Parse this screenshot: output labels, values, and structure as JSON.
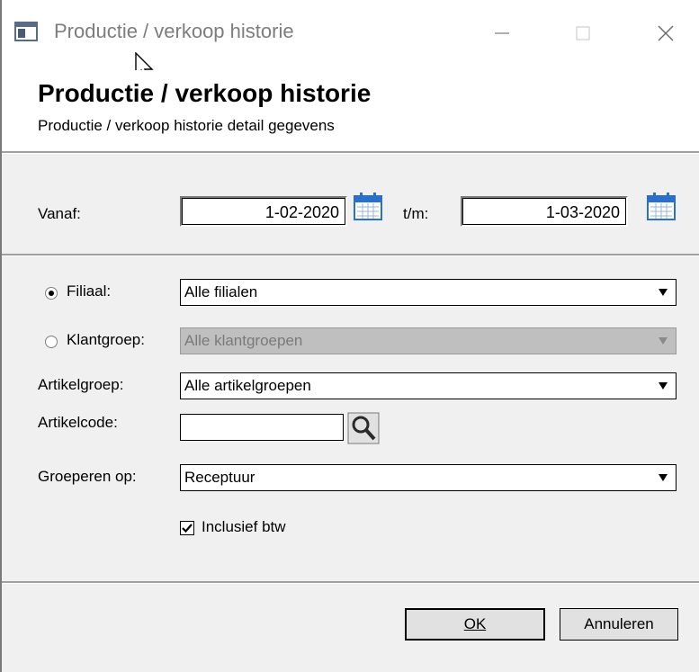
{
  "window": {
    "title": "Productie / verkoop historie",
    "controls": {
      "minimize": "—",
      "maximize": "☐",
      "close": "✕"
    }
  },
  "header": {
    "title": "Productie / verkoop historie",
    "subtitle": "Productie / verkoop historie detail gegevens"
  },
  "dates": {
    "from_label": "Vanaf:",
    "from_value": "1-02-2020",
    "to_label": "t/m:",
    "to_value": "1-03-2020"
  },
  "filters": {
    "filiaal_label": "Filiaal:",
    "filiaal_value": "Alle filialen",
    "filiaal_selected": true,
    "klantgroep_label": "Klantgroep:",
    "klantgroep_value": "Alle klantgroepen",
    "klantgroep_selected": false,
    "artikelgroep_label": "Artikelgroep:",
    "artikelgroep_value": "Alle artikelgroepen",
    "artikelcode_label": "Artikelcode:",
    "artikelcode_value": "",
    "groeperen_label": "Groeperen op:",
    "groeperen_value": "Receptuur",
    "btw_label": "Inclusief btw",
    "btw_checked": true
  },
  "buttons": {
    "ok_label": "OK",
    "cancel_label": "Annuleren"
  },
  "icons": {
    "app": "app-window-icon",
    "calendar": "calendar-icon",
    "search": "magnifier-icon",
    "dropdown": "dropdown-arrow-icon"
  },
  "colors": {
    "dialog_bg": "#f0f0f0",
    "header_bg": "#ffffff",
    "calendar_blue": "#2a6fc9",
    "disabled_combo": "#bfbfbf"
  }
}
